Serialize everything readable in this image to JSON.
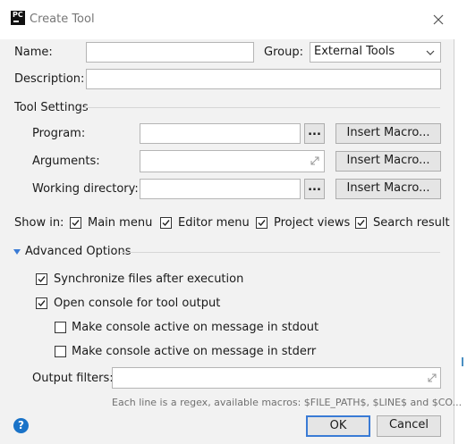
{
  "window": {
    "title": "Create Tool",
    "app_icon_text": "PC"
  },
  "form": {
    "name_label": "Name:",
    "name_value": "",
    "group_label": "Group:",
    "group_value": "External Tools",
    "description_label": "Description:",
    "description_value": ""
  },
  "tool_settings": {
    "section_label": "Tool Settings",
    "program_label": "Program:",
    "program_value": "",
    "arguments_label": "Arguments:",
    "arguments_value": "",
    "working_dir_label": "Working directory:",
    "working_dir_value": "",
    "browse_label": "...",
    "insert_macro_label": "Insert Macro..."
  },
  "show_in": {
    "label": "Show in:",
    "options": [
      {
        "label": "Main menu",
        "checked": true
      },
      {
        "label": "Editor menu",
        "checked": true
      },
      {
        "label": "Project views",
        "checked": true
      },
      {
        "label": "Search result",
        "checked": true
      }
    ]
  },
  "advanced": {
    "section_label": "Advanced Options",
    "expanded": true,
    "sync_label": "Synchronize files after execution",
    "sync_checked": true,
    "console_label": "Open console for tool output",
    "console_checked": true,
    "stdout_label": "Make console active on message in stdout",
    "stdout_checked": false,
    "stderr_label": "Make console active on message in stderr",
    "stderr_checked": false,
    "output_filters_label": "Output filters:",
    "output_filters_value": "",
    "hint": "Each line is a regex, available macros: $FILE_PATH$, $LINE$ and $CO..."
  },
  "footer": {
    "help_label": "?",
    "ok_label": "OK",
    "cancel_label": "Cancel"
  },
  "colors": {
    "dialog_bg": "#f2f2f2",
    "accent": "#3a7bd5",
    "help_blue": "#1a73c8"
  }
}
